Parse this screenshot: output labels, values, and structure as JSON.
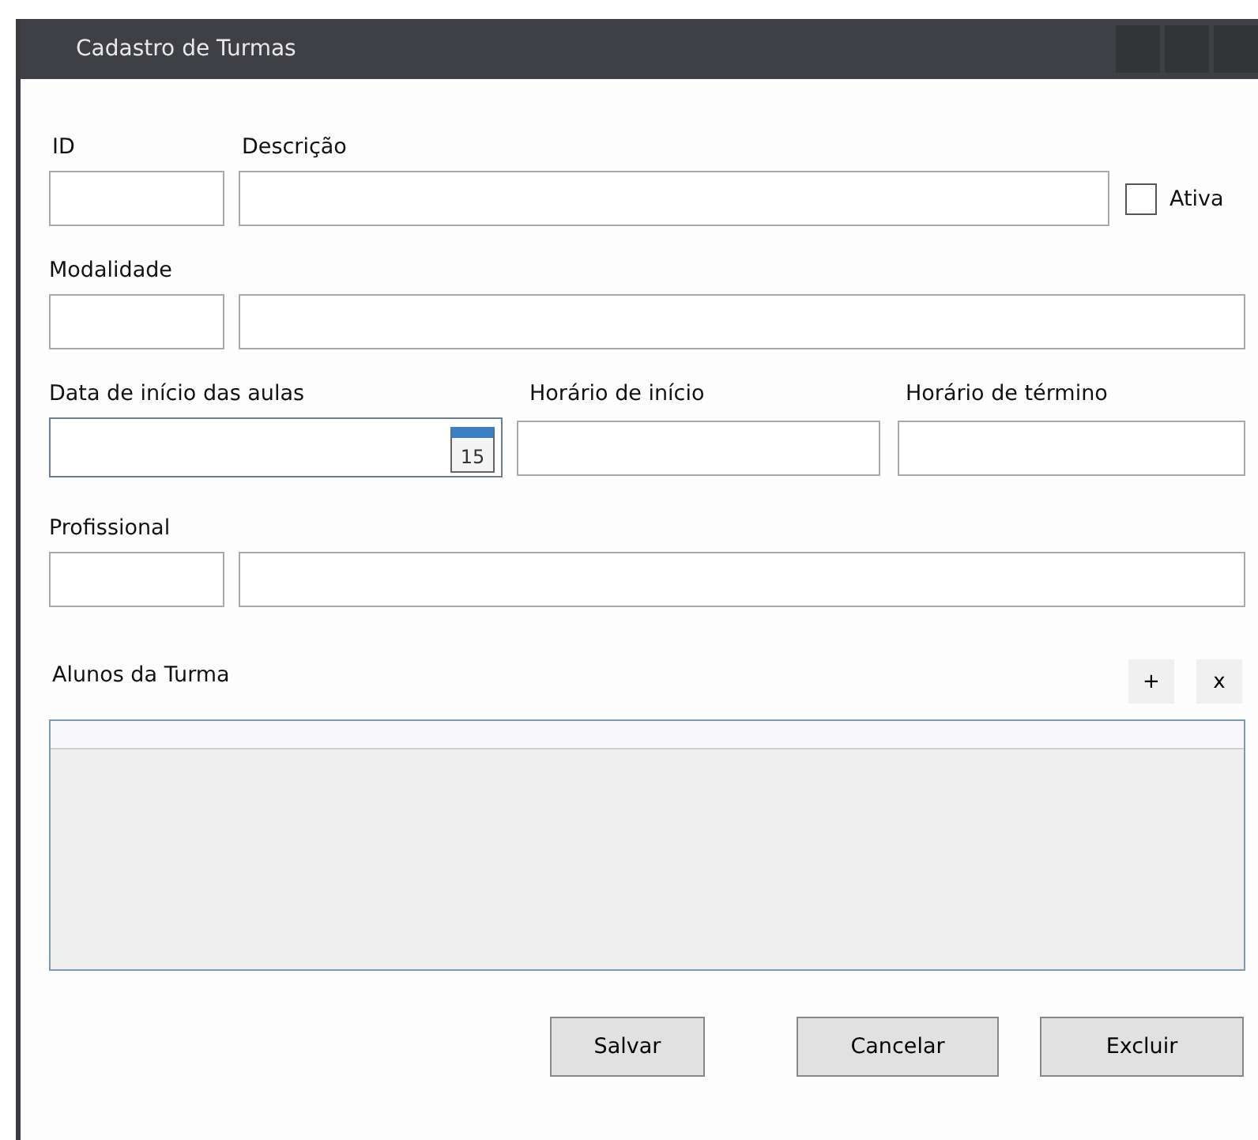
{
  "window": {
    "title": "Cadastro de Turmas"
  },
  "row1": {
    "labels": [
      "ID",
      "Descrição"
    ],
    "active": {
      "label": "Ativa",
      "checked": false
    }
  },
  "row2": {
    "label": "Modalidade"
  },
  "row3": {
    "labels": [
      "Data de início das aulas",
      "Horário de início",
      "Horário de término"
    ],
    "calendar_day": "15"
  },
  "row4": {
    "label": "Profissional"
  },
  "students": {
    "label": "Alunos da Turma",
    "add": "+",
    "remove": "x"
  },
  "buttons": [
    "Salvar",
    "Cancelar",
    "Excluir"
  ]
}
